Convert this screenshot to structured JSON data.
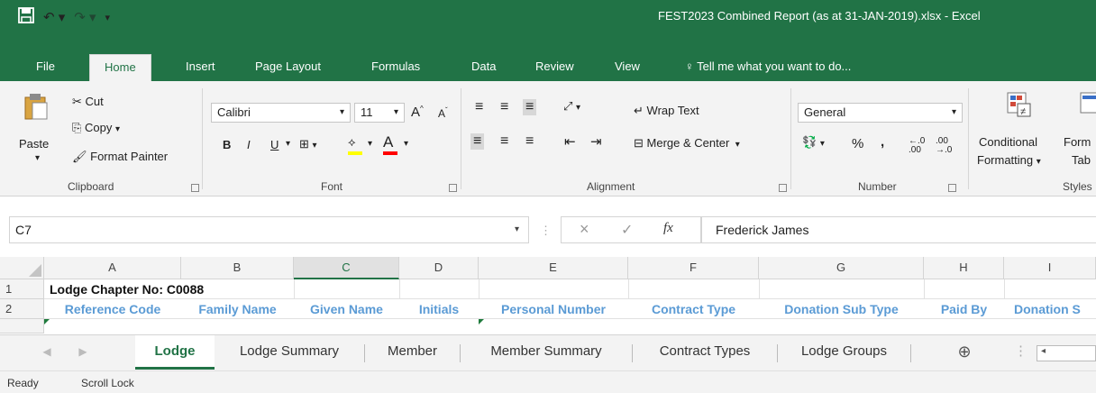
{
  "window": {
    "title": "FEST2023 Combined Report (as at 31-JAN-2019).xlsx - Excel"
  },
  "quick_access": {
    "save_icon": "save-icon",
    "undo_icon": "undo-icon",
    "redo_icon": "redo-icon"
  },
  "tabs": [
    "File",
    "Home",
    "Insert",
    "Page Layout",
    "Formulas",
    "Data",
    "Review",
    "View"
  ],
  "tell_me": "Tell me what you want to do...",
  "ribbon": {
    "clipboard": {
      "paste": "Paste",
      "cut": "Cut",
      "copy": "Copy",
      "format_painter": "Format Painter",
      "label": "Clipboard"
    },
    "font": {
      "name": "Calibri",
      "size": "11",
      "bold": "B",
      "italic": "I",
      "underline": "U",
      "label": "Font",
      "highlight_color": "#ffff00",
      "font_color": "#ff0000"
    },
    "alignment": {
      "wrap_text": "Wrap Text",
      "merge_center": "Merge & Center",
      "label": "Alignment"
    },
    "number": {
      "format": "General",
      "percent": "%",
      "comma": ",",
      "label": "Number"
    },
    "styles": {
      "conditional_formatting_1": "Conditional",
      "conditional_formatting_2": "Formatting",
      "format_table_1": "Form",
      "format_table_2": "Tab",
      "label": "Styles"
    }
  },
  "formula_bar": {
    "name_box": "C7",
    "cancel": "×",
    "enter": "✓",
    "fx": "fx",
    "value": "Frederick James"
  },
  "columns": [
    "A",
    "B",
    "C",
    "D",
    "E",
    "F",
    "G",
    "H",
    "I"
  ],
  "selected_column": "C",
  "rows": [
    {
      "num": "1",
      "cells": [
        "Lodge Chapter No: C0088"
      ]
    },
    {
      "num": "2",
      "cells": [
        "Reference Code",
        "Family Name",
        "Given Name",
        "Initials",
        "Personal Number",
        "Contract Type",
        "Donation Sub Type",
        "Paid By",
        "Donation S"
      ]
    }
  ],
  "sheets": [
    "Lodge",
    "Lodge Summary",
    "Member",
    "Member Summary",
    "Contract Types",
    "Lodge Groups"
  ],
  "active_sheet": "Lodge",
  "status": {
    "ready": "Ready",
    "scroll_lock": "Scroll Lock"
  },
  "colors": {
    "accent": "#217346",
    "header_text": "#5b9bd5"
  }
}
